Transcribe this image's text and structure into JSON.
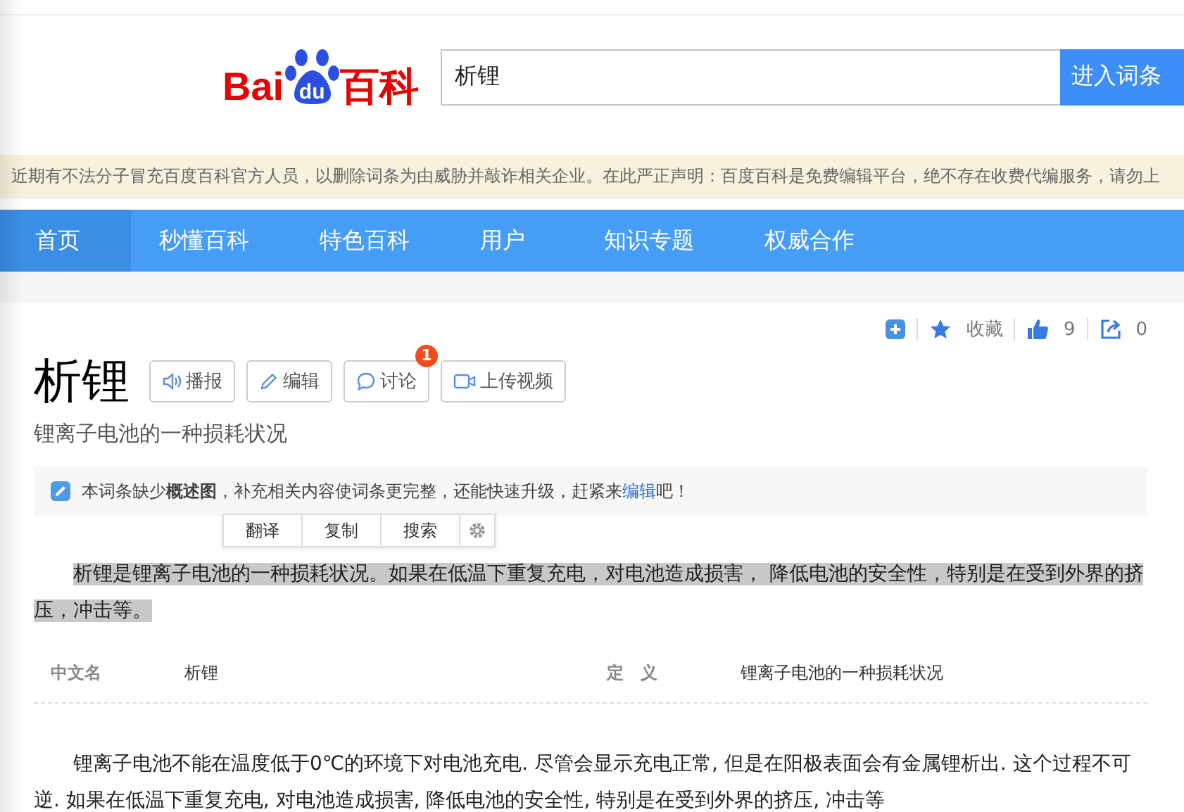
{
  "logo": {
    "parts": [
      "Bai",
      "du",
      "百科"
    ]
  },
  "search": {
    "value": "析锂",
    "button": "进入词条"
  },
  "notice": "近期有不法分子冒充百度百科官方人员，以删除词条为由威胁并敲诈相关企业。在此严正声明：百度百科是免费编辑平台，绝不存在收费代编服务，请勿上",
  "nav": [
    {
      "label": "首页",
      "selected": true
    },
    {
      "label": "秒懂百科",
      "selected": false
    },
    {
      "label": "特色百科",
      "selected": false
    },
    {
      "label": "用户",
      "selected": false
    },
    {
      "label": "知识专题",
      "selected": false
    },
    {
      "label": "权威合作",
      "selected": false
    }
  ],
  "actions": [
    {
      "kind": "add"
    },
    {
      "kind": "star",
      "label": "收藏"
    },
    {
      "kind": "like",
      "label": "9"
    },
    {
      "kind": "share",
      "label": "0"
    }
  ],
  "title": "析锂",
  "tools": [
    {
      "kind": "speaker",
      "label": "播报"
    },
    {
      "kind": "pencil",
      "label": "编辑"
    },
    {
      "kind": "chat",
      "label": "讨论",
      "badge": "1"
    },
    {
      "kind": "video",
      "label": "上传视频"
    }
  ],
  "subtitle": "锂离子电池的一种损耗状况",
  "tip": {
    "text": "本词条缺少**概述图**，补充相关内容使词条更完整，还能快速升级，赶紧来",
    "link": "编辑",
    "after": "吧！"
  },
  "popup": [
    "翻译",
    "复制",
    "搜索"
  ],
  "summary": {
    "text": "析锂是锂离子电池的一种损耗状况。如果在低温下重复充电，对电池造成损害， 降低电池的安全性，特别是在受到外界的挤压，冲击等。",
    "selected": true
  },
  "basic_info": [
    {
      "name": "中文名",
      "value": "析锂"
    },
    {
      "name": "定　义",
      "value": "锂离子电池的一种损耗状况"
    }
  ],
  "body": "锂离子电池不能在温度低于0℃的环境下对电池充电. 尽管会显示充电正常, 但是在阳极表面会有金属锂析出. 这个过程不可逆. 如果在低温下重复充电, 对电池造成损害, 降低电池的安全性, 特别是在受到外界的挤压, 冲击等"
}
